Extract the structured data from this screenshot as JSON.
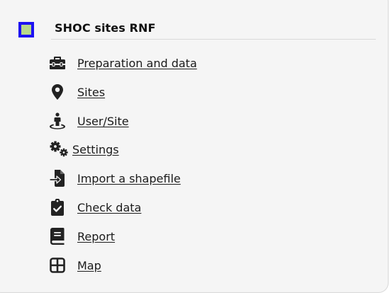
{
  "layer": {
    "title": "SHOC sites RNF",
    "swatch_fill": "#b9d98a",
    "swatch_border": "#1d12f2"
  },
  "menu": {
    "items": [
      {
        "label": "Preparation and data",
        "icon": "toolbox-icon"
      },
      {
        "label": "Sites",
        "icon": "map-marker-icon"
      },
      {
        "label": "User/Site",
        "icon": "street-view-icon"
      },
      {
        "label": "Settings",
        "icon": "gears-icon"
      },
      {
        "label": "Import a shapefile",
        "icon": "file-import-icon"
      },
      {
        "label": "Check data",
        "icon": "clipboard-check-icon"
      },
      {
        "label": "Report",
        "icon": "book-icon"
      },
      {
        "label": "Map",
        "icon": "grid-icon"
      }
    ]
  }
}
